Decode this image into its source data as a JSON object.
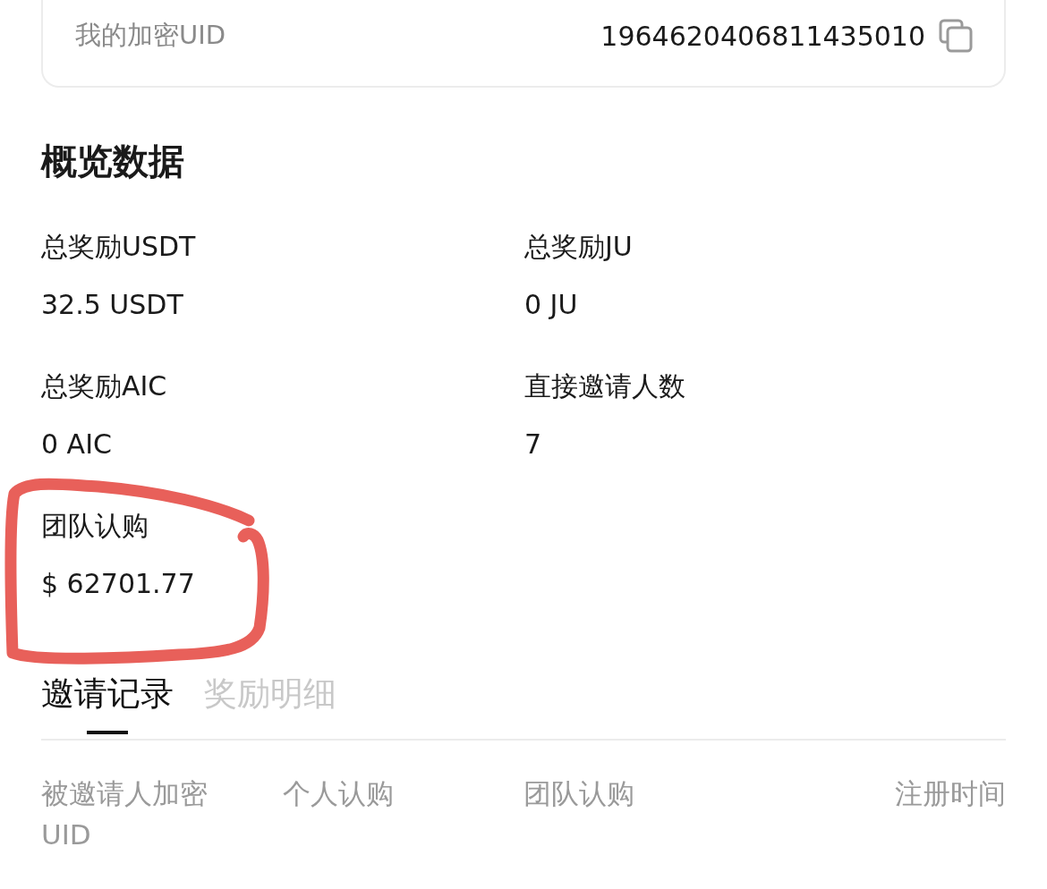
{
  "uid_card": {
    "label": "我的加密UID",
    "value": "1964620406811435010"
  },
  "overview": {
    "title": "概览数据",
    "stats": [
      {
        "label": "总奖励USDT",
        "value": "32.5 USDT"
      },
      {
        "label": "总奖励JU",
        "value": "0 JU"
      },
      {
        "label": "总奖励AIC",
        "value": "0 AIC"
      },
      {
        "label": "直接邀请人数",
        "value": "7"
      },
      {
        "label": "团队认购",
        "value": "$ 62701.77"
      }
    ]
  },
  "tabs": [
    {
      "label": "邀请记录",
      "selected": true
    },
    {
      "label": "奖励明细",
      "selected": false
    }
  ],
  "table": {
    "columns": [
      "被邀请人加密UID",
      "个人认购",
      "团队认购",
      "注册时间"
    ]
  }
}
